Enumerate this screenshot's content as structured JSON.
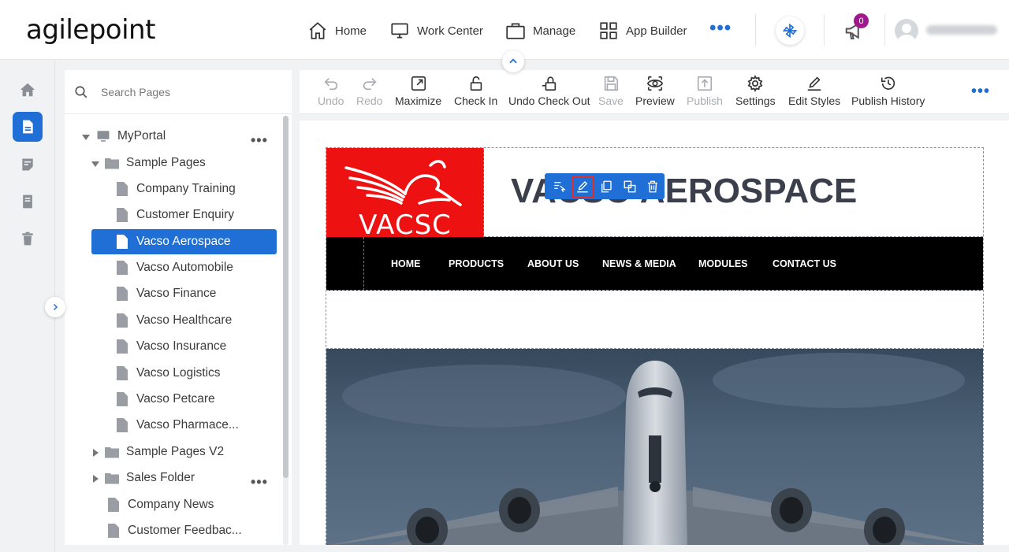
{
  "header": {
    "logo": "agilepoint",
    "nav": [
      {
        "label": "Home",
        "icon": "home-icon"
      },
      {
        "label": "Work Center",
        "icon": "monitor-icon"
      },
      {
        "label": "Manage",
        "icon": "briefcase-icon"
      },
      {
        "label": "App Builder",
        "icon": "grid-icon"
      }
    ],
    "more": "•••",
    "notification_count": "0"
  },
  "search": {
    "placeholder": "Search Pages"
  },
  "tree": {
    "root": "MyPortal",
    "items": [
      {
        "label": "Sample Pages"
      },
      {
        "label": "Company Training"
      },
      {
        "label": "Customer Enquiry"
      },
      {
        "label": "Vacso Aerospace"
      },
      {
        "label": "Vacso Automobile"
      },
      {
        "label": "Vacso Finance"
      },
      {
        "label": "Vacso Healthcare"
      },
      {
        "label": "Vacso Insurance"
      },
      {
        "label": "Vacso Logistics"
      },
      {
        "label": "Vacso Petcare"
      },
      {
        "label": "Vacso Pharmace..."
      },
      {
        "label": "Sample Pages V2"
      },
      {
        "label": "Sales Folder"
      },
      {
        "label": "Company News"
      },
      {
        "label": "Customer Feedbac..."
      }
    ],
    "selected": "Vacso Aerospace"
  },
  "toolbar": {
    "undo": "Undo",
    "redo": "Redo",
    "maximize": "Maximize",
    "check_in": "Check In",
    "undo_check_out": "Undo Check Out",
    "save": "Save",
    "preview": "Preview",
    "publish": "Publish",
    "settings": "Settings",
    "edit_styles": "Edit Styles",
    "publish_history": "Publish History",
    "more": "•••"
  },
  "site": {
    "logo_text": "VACSC",
    "title": "VACSO AEROSPACE",
    "menu": [
      "HOME",
      "PRODUCTS",
      "ABOUT US",
      "NEWS & MEDIA",
      "MODULES",
      "CONTACT US"
    ]
  },
  "colors": {
    "accent": "#1f6fd6",
    "logo_red": "#ee1111",
    "badge": "#a0198c",
    "highlight": "#e0302a"
  }
}
